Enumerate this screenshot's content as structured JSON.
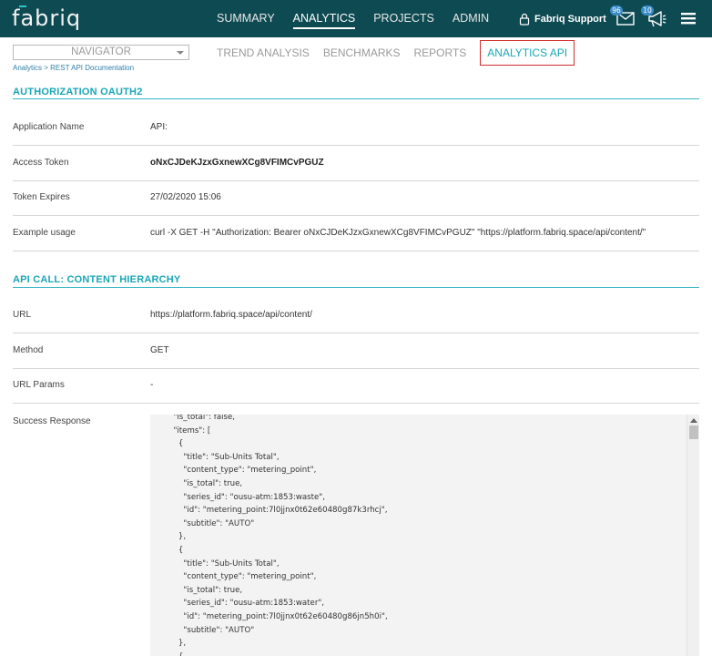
{
  "app": {
    "logo": "fabriq"
  },
  "mainnav": {
    "items": [
      {
        "label": "SUMMARY",
        "active": false
      },
      {
        "label": "ANALYTICS",
        "active": true
      },
      {
        "label": "PROJECTS",
        "active": false
      },
      {
        "label": "ADMIN",
        "active": false
      }
    ]
  },
  "user": {
    "name": "Fabriq Support",
    "messages_count": "96",
    "announcements_count": "10"
  },
  "subnav": {
    "navigator_placeholder": "NAVIGATOR",
    "breadcrumb": {
      "root": "Analytics",
      "separator": ">",
      "current": "REST API Documentation"
    },
    "tabs": [
      {
        "label": "TREND ANALYSIS",
        "active": false
      },
      {
        "label": "BENCHMARKS",
        "active": false
      },
      {
        "label": "REPORTS",
        "active": false
      },
      {
        "label": "ANALYTICS API",
        "active": true
      }
    ]
  },
  "auth": {
    "title": "AUTHORIZATION OAUTH2",
    "rows": [
      {
        "label": "Application Name",
        "value": "API:"
      },
      {
        "label": "Access Token",
        "value": "oNxCJDeKJzxGxnewXCg8VFIMCvPGUZ"
      },
      {
        "label": "Token Expires",
        "value": "27/02/2020 15:06"
      },
      {
        "label": "Example usage",
        "value": "curl -X GET -H \"Authorization: Bearer oNxCJDeKJzxGxnewXCg8VFIMCvPGUZ\" \"https://platform.fabriq.space/api/content/\""
      }
    ]
  },
  "api": {
    "title": "API CALL: CONTENT HIERARCHY",
    "rows": [
      {
        "label": "URL",
        "value": "https://platform.fabriq.space/api/content/"
      },
      {
        "label": "Method",
        "value": "GET"
      },
      {
        "label": "URL Params",
        "value": "-"
      }
    ],
    "response_label": "Success Response",
    "response_body": "  \"is_total\": false,\n  \"items\": [\n    {\n      \"title\": \"Sub-Units Total\",\n      \"content_type\": \"metering_point\",\n      \"is_total\": true,\n      \"series_id\": \"ousu-atm:1853:waste\",\n      \"id\": \"metering_point:7l0jjnx0t62e60480g87k3rhcj\",\n      \"subtitle\": \"AUTO\"\n    },\n    {\n      \"title\": \"Sub-Units Total\",\n      \"content_type\": \"metering_point\",\n      \"is_total\": true,\n      \"series_id\": \"ousu-atm:1853:water\",\n      \"id\": \"metering_point:7l0jjnx0t62e60480g86jn5h0i\",\n      \"subtitle\": \"AUTO\"\n    },\n    {"
  },
  "colors": {
    "topbar": "#0e4a52",
    "accent": "#1aa6b7",
    "highlight_border": "#d22b2b"
  }
}
